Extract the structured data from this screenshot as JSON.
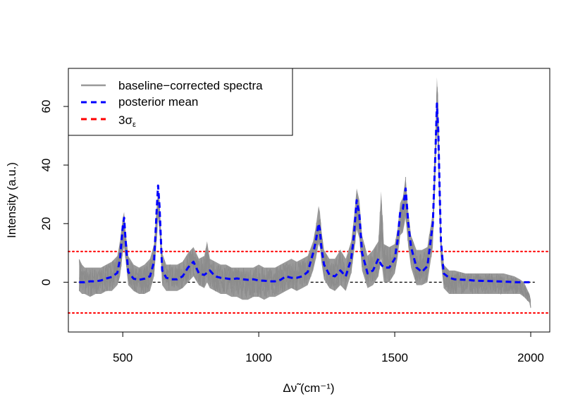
{
  "chart_data": {
    "type": "line",
    "xlabel": "Δν̃ (cm⁻¹)",
    "ylabel": "Intensity (a.u.)",
    "xlim": [
      300,
      2070
    ],
    "ylim": [
      -17,
      73
    ],
    "xticks": [
      500,
      1000,
      1500,
      2000
    ],
    "yticks": [
      0,
      20,
      40,
      60
    ],
    "grid": false,
    "legend_position": "top-left",
    "legend": [
      {
        "label": "baseline−corrected spectra",
        "color": "#999999",
        "style": "solid"
      },
      {
        "label": "posterior mean",
        "color": "#0000ff",
        "style": "dashed"
      },
      {
        "label": "3σ",
        "sub": "ε",
        "color": "#ff0000",
        "style": "dashed"
      }
    ],
    "reference_lines": [
      {
        "y": 0,
        "color": "#000000",
        "style": "dashed"
      },
      {
        "y": 10.5,
        "color": "#ff0000",
        "style": "dotted"
      },
      {
        "y": -10.5,
        "color": "#ff0000",
        "style": "dotted"
      }
    ],
    "posterior_mean": {
      "x": [
        340,
        360,
        380,
        400,
        420,
        440,
        460,
        480,
        490,
        500,
        505,
        510,
        520,
        540,
        560,
        580,
        600,
        615,
        625,
        630,
        635,
        645,
        660,
        680,
        700,
        720,
        740,
        760,
        780,
        800,
        820,
        840,
        860,
        880,
        900,
        920,
        940,
        960,
        980,
        1000,
        1020,
        1040,
        1060,
        1080,
        1100,
        1120,
        1140,
        1160,
        1180,
        1200,
        1210,
        1220,
        1225,
        1230,
        1240,
        1260,
        1280,
        1300,
        1320,
        1340,
        1350,
        1360,
        1370,
        1380,
        1400,
        1420,
        1440,
        1450,
        1460,
        1480,
        1500,
        1510,
        1520,
        1530,
        1540,
        1550,
        1560,
        1580,
        1600,
        1620,
        1640,
        1650,
        1655,
        1660,
        1665,
        1670,
        1680,
        1700,
        1720,
        1760,
        1800,
        1850,
        1900,
        1950,
        2000
      ],
      "y": [
        0,
        0,
        0.3,
        0.3,
        0.6,
        1.3,
        1.8,
        3.2,
        8,
        19,
        22,
        15,
        3.5,
        1.2,
        0.8,
        1.2,
        2,
        7,
        25,
        33,
        26,
        4,
        1.5,
        1,
        1,
        2,
        5,
        7,
        3,
        2.5,
        4,
        2,
        1.5,
        1.3,
        1,
        1.3,
        1,
        0.8,
        1,
        0.6,
        0.5,
        0.3,
        0.3,
        0.8,
        2,
        1.5,
        1.5,
        2,
        3.5,
        10,
        14,
        20,
        18,
        12,
        6,
        2.5,
        2,
        4,
        2,
        8,
        16,
        28,
        23,
        10,
        3,
        4,
        8,
        6,
        5,
        5,
        8,
        14,
        24,
        25,
        32,
        20,
        12,
        5,
        3.5,
        5.5,
        20,
        45,
        61,
        52,
        32,
        14,
        3,
        1.5,
        1,
        0.8,
        0.5,
        0.4,
        0.2,
        0,
        0
      ]
    },
    "spectra": {
      "x": [
        340,
        350,
        360,
        380,
        400,
        420,
        440,
        460,
        480,
        490,
        500,
        505,
        510,
        520,
        540,
        560,
        580,
        600,
        615,
        625,
        630,
        635,
        645,
        660,
        680,
        700,
        720,
        740,
        760,
        780,
        800,
        810,
        820,
        840,
        860,
        880,
        900,
        920,
        940,
        960,
        980,
        1000,
        1020,
        1040,
        1060,
        1080,
        1100,
        1120,
        1140,
        1160,
        1180,
        1200,
        1210,
        1220,
        1225,
        1230,
        1240,
        1260,
        1280,
        1300,
        1320,
        1340,
        1350,
        1360,
        1370,
        1380,
        1400,
        1420,
        1440,
        1450,
        1460,
        1480,
        1500,
        1510,
        1520,
        1530,
        1540,
        1550,
        1560,
        1580,
        1600,
        1620,
        1640,
        1650,
        1655,
        1660,
        1665,
        1670,
        1680,
        1700,
        1720,
        1760,
        1800,
        1850,
        1900,
        1940,
        1960,
        1975,
        1985,
        1995,
        2000
      ],
      "low": [
        -3,
        -4,
        -4,
        -5,
        -4,
        -4,
        -3,
        -3,
        -1,
        2,
        10,
        12,
        8,
        -1,
        -3,
        -4,
        -4,
        -3,
        2,
        15,
        22,
        18,
        -1,
        -3,
        -3,
        -3,
        -2,
        0,
        2,
        -1,
        -2,
        0,
        -2,
        -3,
        -4,
        -4,
        -5,
        -5,
        -6,
        -6,
        -5,
        -5,
        -6,
        -5,
        -5,
        -4,
        -3,
        -2,
        -3,
        -2,
        -1,
        4,
        8,
        13,
        12,
        7,
        1,
        -2,
        -3,
        -1,
        -3,
        3,
        10,
        18,
        15,
        4,
        -2,
        -1,
        2,
        8,
        0,
        0,
        3,
        8,
        16,
        17,
        22,
        12,
        5,
        -1,
        -1,
        0,
        12,
        38,
        52,
        44,
        24,
        7,
        -2,
        -4,
        -4,
        -4,
        -4,
        -4,
        -4,
        -4,
        -4,
        -5,
        -6,
        -7,
        -9,
        -11
      ],
      "high": [
        8,
        6,
        5,
        5,
        5,
        5,
        6,
        7,
        9,
        14,
        22,
        24,
        18,
        9,
        6,
        5,
        6,
        8,
        13,
        26,
        31,
        28,
        10,
        6,
        6,
        6,
        7,
        10,
        12,
        8,
        9,
        14,
        8,
        7,
        6,
        6,
        5,
        5,
        5,
        5,
        5,
        6,
        5,
        5,
        5,
        6,
        7,
        8,
        7,
        8,
        9,
        14,
        19,
        26,
        24,
        18,
        11,
        8,
        8,
        11,
        8,
        14,
        22,
        32,
        28,
        16,
        9,
        11,
        14,
        31,
        13,
        12,
        13,
        18,
        27,
        29,
        36,
        24,
        16,
        11,
        11,
        12,
        24,
        52,
        70,
        60,
        38,
        16,
        6,
        4,
        4,
        3,
        3,
        3,
        3,
        2,
        1,
        0,
        -2,
        -4,
        -6
      ]
    }
  }
}
